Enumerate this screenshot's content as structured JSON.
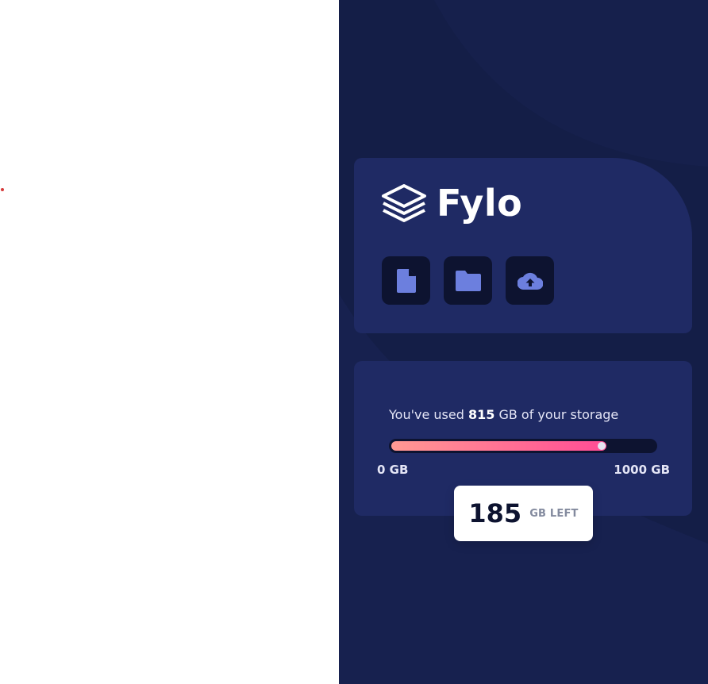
{
  "brand": {
    "name": "Fylo",
    "logo_icon": "layers-icon"
  },
  "actions": [
    {
      "icon": "document-icon"
    },
    {
      "icon": "folder-icon"
    },
    {
      "icon": "cloud-upload-icon"
    }
  ],
  "storage": {
    "text_prefix": "You've used",
    "used_value": "815",
    "text_suffix": "GB of your storage",
    "used_fraction": 0.815,
    "scale_min_label": "0 GB",
    "scale_max_label": "1000 GB",
    "remaining_value": "185",
    "remaining_unit": "GB LEFT"
  },
  "colors": {
    "page_bg_right": "#141e47",
    "card_bg": "#1f2a64",
    "icon_btn_bg": "#0d1330",
    "icon_color": "#6c7fde",
    "bar_gradient_start": "#ff9993",
    "bar_gradient_end": "#ff4c95"
  }
}
